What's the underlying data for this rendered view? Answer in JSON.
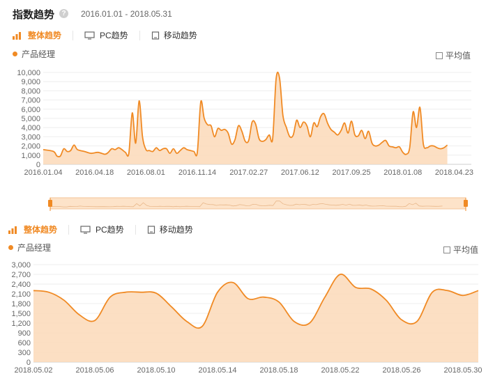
{
  "header": {
    "title": "指数趋势",
    "help_icon": "?",
    "date_range": "2016.01.01 - 2018.05.31"
  },
  "tabs": [
    {
      "label": "整体趋势",
      "icon": "bar-chart-icon",
      "active": true
    },
    {
      "label": "PC趋势",
      "icon": "monitor-icon",
      "active": false
    },
    {
      "label": "移动趋势",
      "icon": "mobile-icon",
      "active": false
    }
  ],
  "legend_label": "产品经理",
  "average_label": "平均值",
  "colors": {
    "accent": "#f08a24",
    "fill": "#fbd9b8",
    "grid": "#eeeeee",
    "axis_text": "#666666"
  },
  "chart_data": [
    {
      "type": "area",
      "series": [
        {
          "name": "产品经理"
        }
      ],
      "ylim": [
        0,
        10000
      ],
      "yticks": [
        "0",
        "1,000",
        "2,000",
        "3,000",
        "4,000",
        "5,000",
        "6,000",
        "7,000",
        "8,000",
        "9,000",
        "10,000"
      ],
      "xticks": [
        "2016.01.04",
        "2016.04.18",
        "2016.08.01",
        "2016.11.14",
        "2017.02.27",
        "2017.06.12",
        "2017.09.25",
        "2018.01.08",
        "2018.04.23"
      ],
      "xmax_week": 125,
      "points": [
        [
          0,
          1600
        ],
        [
          3,
          1400
        ],
        [
          4,
          900
        ],
        [
          5,
          900
        ],
        [
          6,
          1700
        ],
        [
          7,
          1400
        ],
        [
          8,
          1500
        ],
        [
          9,
          2100
        ],
        [
          10,
          1600
        ],
        [
          12,
          1400
        ],
        [
          14,
          1200
        ],
        [
          16,
          1300
        ],
        [
          18,
          1100
        ],
        [
          19,
          1300
        ],
        [
          20,
          1700
        ],
        [
          21,
          1600
        ],
        [
          22,
          1800
        ],
        [
          23,
          1600
        ],
        [
          24,
          1300
        ],
        [
          25,
          1200
        ],
        [
          26,
          5600
        ],
        [
          27,
          2300
        ],
        [
          28,
          6900
        ],
        [
          29,
          3000
        ],
        [
          30,
          1600
        ],
        [
          31,
          1500
        ],
        [
          32,
          1400
        ],
        [
          33,
          1800
        ],
        [
          34,
          1500
        ],
        [
          35,
          1700
        ],
        [
          36,
          1700
        ],
        [
          37,
          1200
        ],
        [
          38,
          1700
        ],
        [
          39,
          1200
        ],
        [
          40,
          1500
        ],
        [
          41,
          1800
        ],
        [
          42,
          1600
        ],
        [
          43,
          1500
        ],
        [
          44,
          1400
        ],
        [
          45,
          1300
        ],
        [
          46,
          6800
        ],
        [
          47,
          5000
        ],
        [
          48,
          4300
        ],
        [
          49,
          4200
        ],
        [
          50,
          3000
        ],
        [
          51,
          3900
        ],
        [
          52,
          3700
        ],
        [
          53,
          3800
        ],
        [
          54,
          3400
        ],
        [
          55,
          2200
        ],
        [
          56,
          2700
        ],
        [
          57,
          4200
        ],
        [
          58,
          3600
        ],
        [
          59,
          2500
        ],
        [
          60,
          2600
        ],
        [
          61,
          4600
        ],
        [
          62,
          4400
        ],
        [
          63,
          2800
        ],
        [
          64,
          2500
        ],
        [
          65,
          2700
        ],
        [
          66,
          3200
        ],
        [
          67,
          2800
        ],
        [
          68,
          9300
        ],
        [
          69,
          9400
        ],
        [
          70,
          5300
        ],
        [
          71,
          4000
        ],
        [
          72,
          3000
        ],
        [
          73,
          3200
        ],
        [
          74,
          4800
        ],
        [
          75,
          4000
        ],
        [
          76,
          4600
        ],
        [
          77,
          4200
        ],
        [
          78,
          3000
        ],
        [
          79,
          4500
        ],
        [
          80,
          4100
        ],
        [
          81,
          5200
        ],
        [
          82,
          5500
        ],
        [
          83,
          4500
        ],
        [
          84,
          3800
        ],
        [
          85,
          3500
        ],
        [
          86,
          3200
        ],
        [
          87,
          3700
        ],
        [
          88,
          4500
        ],
        [
          89,
          3400
        ],
        [
          90,
          4700
        ],
        [
          91,
          3200
        ],
        [
          92,
          3100
        ],
        [
          93,
          3700
        ],
        [
          94,
          2800
        ],
        [
          95,
          3600
        ],
        [
          96,
          2300
        ],
        [
          97,
          2000
        ],
        [
          98,
          2100
        ],
        [
          99,
          2400
        ],
        [
          100,
          2600
        ],
        [
          101,
          2000
        ],
        [
          102,
          1900
        ],
        [
          103,
          1800
        ],
        [
          104,
          1900
        ],
        [
          105,
          1300
        ],
        [
          106,
          1100
        ],
        [
          107,
          1800
        ],
        [
          108,
          5700
        ],
        [
          109,
          4000
        ],
        [
          110,
          6200
        ],
        [
          111,
          2200
        ],
        [
          112,
          1800
        ],
        [
          113,
          2000
        ],
        [
          114,
          2000
        ],
        [
          115,
          1800
        ],
        [
          116,
          1700
        ],
        [
          117,
          1800
        ],
        [
          118,
          2100
        ]
      ]
    },
    {
      "type": "area",
      "series": [
        {
          "name": "产品经理"
        }
      ],
      "ylim": [
        0,
        3000
      ],
      "yticks": [
        "0",
        "300",
        "600",
        "900",
        "1,200",
        "1,500",
        "1,800",
        "2,100",
        "2,400",
        "2,700",
        "3,000"
      ],
      "xticks": [
        "2018.05.02",
        "2018.05.06",
        "2018.05.10",
        "2018.05.14",
        "2018.05.18",
        "2018.05.22",
        "2018.05.26",
        "2018.05.30"
      ],
      "x": [
        "2018.05.02",
        "2018.05.03",
        "2018.05.04",
        "2018.05.05",
        "2018.05.06",
        "2018.05.07",
        "2018.05.08",
        "2018.05.09",
        "2018.05.10",
        "2018.05.11",
        "2018.05.12",
        "2018.05.13",
        "2018.05.14",
        "2018.05.15",
        "2018.05.16",
        "2018.05.17",
        "2018.05.18",
        "2018.05.19",
        "2018.05.20",
        "2018.05.21",
        "2018.05.22",
        "2018.05.23",
        "2018.05.24",
        "2018.05.25",
        "2018.05.26",
        "2018.05.27",
        "2018.05.28",
        "2018.05.29",
        "2018.05.30"
      ],
      "values": [
        2200,
        2150,
        1900,
        1450,
        1280,
        2000,
        2150,
        2150,
        2120,
        1700,
        1250,
        1100,
        2150,
        2450,
        1950,
        2000,
        1850,
        1250,
        1200,
        2000,
        2700,
        2300,
        2250,
        1900,
        1300,
        1250,
        2150,
        2200,
        2050,
        2200
      ]
    }
  ]
}
